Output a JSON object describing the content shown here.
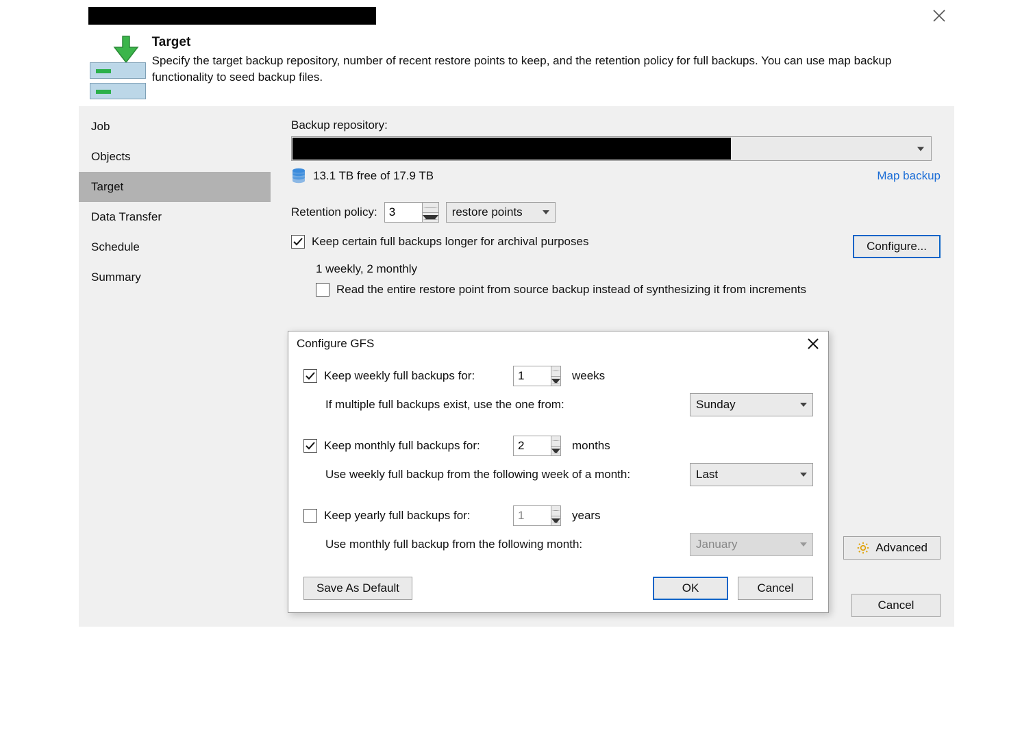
{
  "header": {
    "title": "Target",
    "description": "Specify the target backup repository, number of recent restore points to keep, and the retention policy for full backups. You can use map backup functionality to seed backup files."
  },
  "nav": {
    "items": [
      {
        "label": "Job"
      },
      {
        "label": "Objects"
      },
      {
        "label": "Target"
      },
      {
        "label": "Data Transfer"
      },
      {
        "label": "Schedule"
      },
      {
        "label": "Summary"
      }
    ],
    "selected_index": 2
  },
  "main": {
    "repo_label": "Backup repository:",
    "free_space": "13.1 TB free of 17.9 TB",
    "map_link": "Map backup",
    "retention_label": "Retention policy:",
    "retention_value": "3",
    "retention_unit_selected": "restore points",
    "archival_checkbox": "Keep certain full backups longer for archival purposes",
    "archival_summary": "1 weekly, 2 monthly",
    "configure_btn": "Configure...",
    "read_entire_checkbox": "Read the entire restore point from source backup instead of synthesizing it from increments",
    "advanced_btn": "Advanced",
    "cancel_btn": "Cancel"
  },
  "modal": {
    "title": "Configure GFS",
    "weekly": {
      "enabled": true,
      "label": "Keep weekly full backups for:",
      "value": "1",
      "unit": "weeks",
      "sub_label": "If multiple full backups exist, use the one from:",
      "sub_select": "Sunday"
    },
    "monthly": {
      "enabled": true,
      "label": "Keep monthly full backups for:",
      "value": "2",
      "unit": "months",
      "sub_label": "Use weekly full backup from the following week of a month:",
      "sub_select": "Last"
    },
    "yearly": {
      "enabled": false,
      "label": "Keep yearly full backups for:",
      "value": "1",
      "unit": "years",
      "sub_label": "Use monthly full backup from the following month:",
      "sub_select": "January"
    },
    "save_default_btn": "Save As Default",
    "ok_btn": "OK",
    "cancel_btn": "Cancel"
  }
}
